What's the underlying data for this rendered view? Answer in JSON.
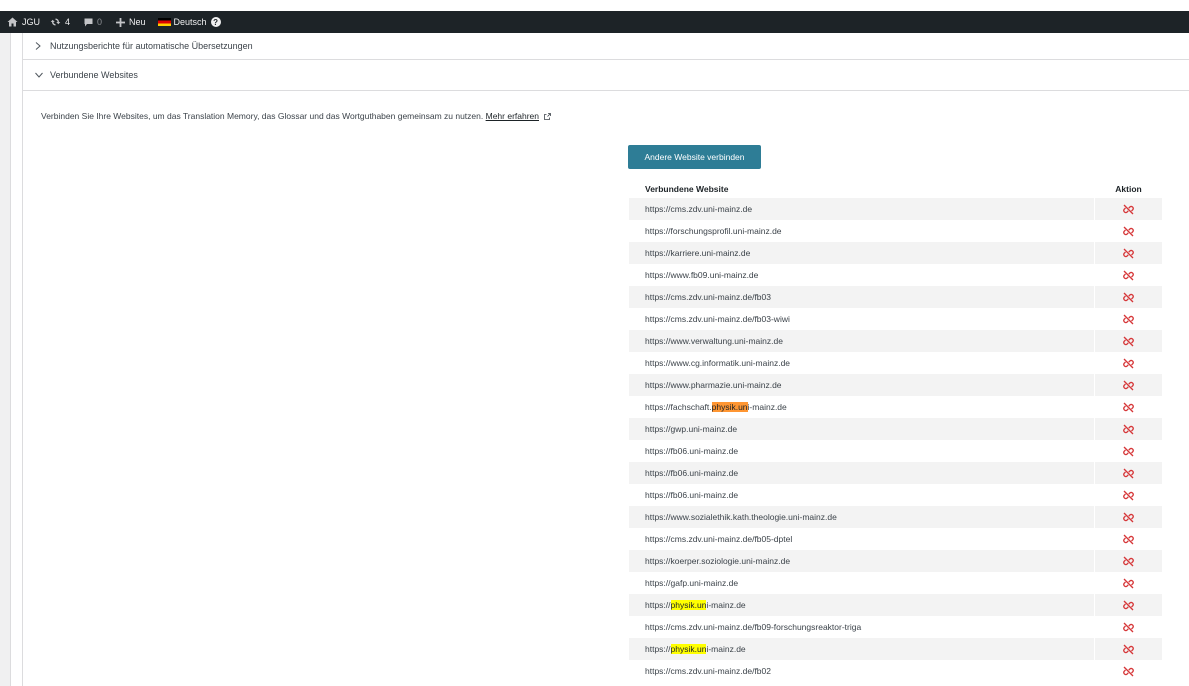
{
  "adminbar": {
    "site_name": "JGU",
    "updates_count": "4",
    "comments_count": "0",
    "new_label": "Neu",
    "language_label": "Deutsch",
    "help_label": "?"
  },
  "sections": {
    "usage_reports_label": "Nutzungsberichte für automatische Übersetzungen",
    "connected_sites_label": "Verbundene Websites"
  },
  "description": {
    "text": "Verbinden Sie Ihre Websites, um das Translation Memory, das Glossar und das Wortguthaben gemeinsam zu nutzen.",
    "link_label": "Mehr erfahren"
  },
  "connect_button_label": "Andere Website verbinden",
  "table": {
    "header_site": "Verbundene Website",
    "header_action": "Aktion",
    "rows": [
      {
        "url": "https://cms.zdv.uni-mainz.de"
      },
      {
        "url": "https://forschungsprofil.uni-mainz.de"
      },
      {
        "url": "https://karriere.uni-mainz.de"
      },
      {
        "url": "https://www.fb09.uni-mainz.de"
      },
      {
        "url": "https://cms.zdv.uni-mainz.de/fb03"
      },
      {
        "url": "https://cms.zdv.uni-mainz.de/fb03-wiwi"
      },
      {
        "url": "https://www.verwaltung.uni-mainz.de"
      },
      {
        "url": "https://www.cg.informatik.uni-mainz.de"
      },
      {
        "url": "https://www.pharmazie.uni-mainz.de"
      },
      {
        "url": "https://fachschaft.physik.uni-mainz.de",
        "hl_pre": "https://fachschaft.",
        "hl": "physik.un",
        "hl_post": "i-mainz.de",
        "hl_color": "orange"
      },
      {
        "url": "https://gwp.uni-mainz.de"
      },
      {
        "url": "https://fb06.uni-mainz.de"
      },
      {
        "url": "https://fb06.uni-mainz.de"
      },
      {
        "url": "https://fb06.uni-mainz.de"
      },
      {
        "url": "https://www.sozialethik.kath.theologie.uni-mainz.de"
      },
      {
        "url": "https://cms.zdv.uni-mainz.de/fb05-dptel"
      },
      {
        "url": "https://koerper.soziologie.uni-mainz.de"
      },
      {
        "url": "https://gafp.uni-mainz.de"
      },
      {
        "url": "https://physik.uni-mainz.de",
        "hl_pre": "https://",
        "hl": "physik.un",
        "hl_post": "i-mainz.de",
        "hl_color": "yellow"
      },
      {
        "url": "https://cms.zdv.uni-mainz.de/fb09-forschungsreaktor-triga"
      },
      {
        "url": "https://physik.uni-mainz.de",
        "hl_pre": "https://",
        "hl": "physik.un",
        "hl_post": "i-mainz.de",
        "hl_color": "yellow"
      },
      {
        "url": "https://cms.zdv.uni-mainz.de/fb02"
      }
    ]
  },
  "colors": {
    "adminbar_bg": "#1d2327",
    "button_bg": "#2e7d96",
    "disconnect_icon": "#d63638",
    "highlight_current": "#ff9632",
    "highlight_other": "#ffff00"
  },
  "icons": {
    "home": "home-icon",
    "updates": "updates-icon",
    "comments": "comment-icon",
    "new": "plus-icon",
    "flag": "german-flag-icon",
    "help": "help-icon",
    "expand": "chevron-right-icon",
    "collapse": "chevron-down-icon",
    "external": "external-link-icon",
    "disconnect": "disconnect-icon"
  }
}
